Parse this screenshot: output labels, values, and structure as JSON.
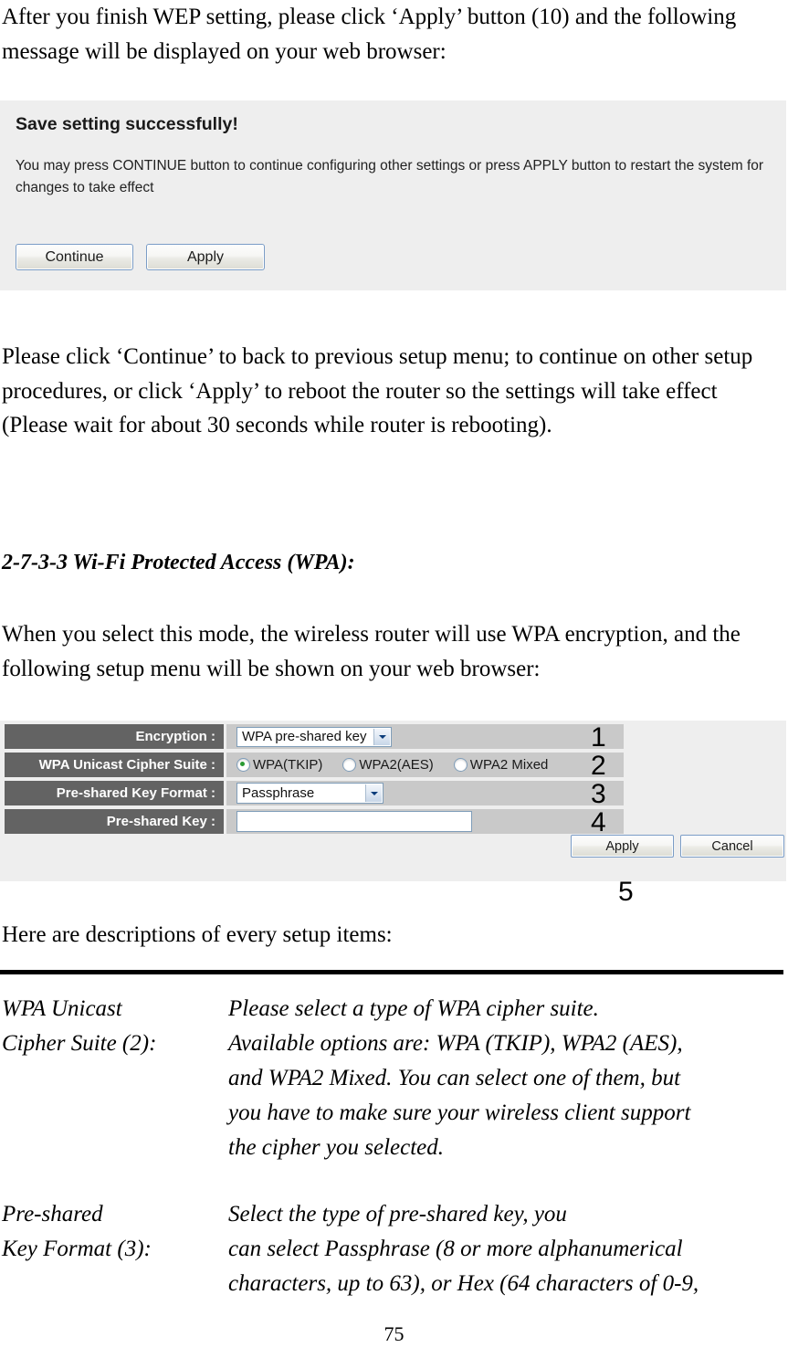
{
  "page": {
    "number": "75"
  },
  "intro": {
    "paragraph": "After you finish WEP setting, please click ‘Apply’ button (10) and the following message will be displayed on your web browser:"
  },
  "save_dialog": {
    "title": "Save setting successfully!",
    "message": "You may press CONTINUE button to continue configuring other settings or press APPLY button to restart the system for changes to take effect",
    "continue_label": "Continue",
    "apply_label": "Apply"
  },
  "after_dialog": {
    "paragraph": "Please click ‘Continue’ to back to previous setup menu; to continue on other setup procedures, or click ‘Apply’ to reboot the router so the settings will take effect (Please wait for about 30 seconds while router is rebooting)."
  },
  "section": {
    "heading": "2-7-3-3 Wi-Fi Protected Access (WPA):",
    "paragraph": "When you select this mode, the wireless router will use WPA encryption, and the following setup menu will be shown on your web browser:"
  },
  "wpa_form": {
    "rows": [
      {
        "label": "Encryption :",
        "type": "select",
        "value": "WPA pre-shared key",
        "callout": "1"
      },
      {
        "label": "WPA Unicast Cipher Suite :",
        "type": "radio",
        "options": [
          {
            "label": "WPA(TKIP)",
            "checked": true
          },
          {
            "label": "WPA2(AES)",
            "checked": false
          },
          {
            "label": "WPA2 Mixed",
            "checked": false
          }
        ],
        "callout": "2"
      },
      {
        "label": "Pre-shared Key Format :",
        "type": "select",
        "value": "Passphrase",
        "callout": "3"
      },
      {
        "label": "Pre-shared Key :",
        "type": "text",
        "value": "",
        "callout": "4"
      }
    ],
    "apply_label": "Apply",
    "cancel_label": "Cancel",
    "buttons_callout": "5"
  },
  "descriptions": {
    "lead": "Here are descriptions of every setup items:",
    "items": [
      {
        "term_lines": [
          "WPA Unicast",
          "Cipher Suite (2):"
        ],
        "desc_lines": [
          "Please select a type of WPA cipher suite.",
          "Available options are: WPA (TKIP), WPA2 (AES),",
          "and WPA2 Mixed. You can select one of them, but",
          "you have to make sure your wireless client support",
          "the cipher you selected."
        ]
      },
      {
        "term_lines": [
          "Pre-shared",
          "Key Format (3):"
        ],
        "desc_lines": [
          "Select the type of pre-shared key, you",
          "can select Passphrase (8 or more alphanumerical",
          "characters, up to 63), or Hex (64 characters of 0-9,"
        ]
      }
    ]
  }
}
